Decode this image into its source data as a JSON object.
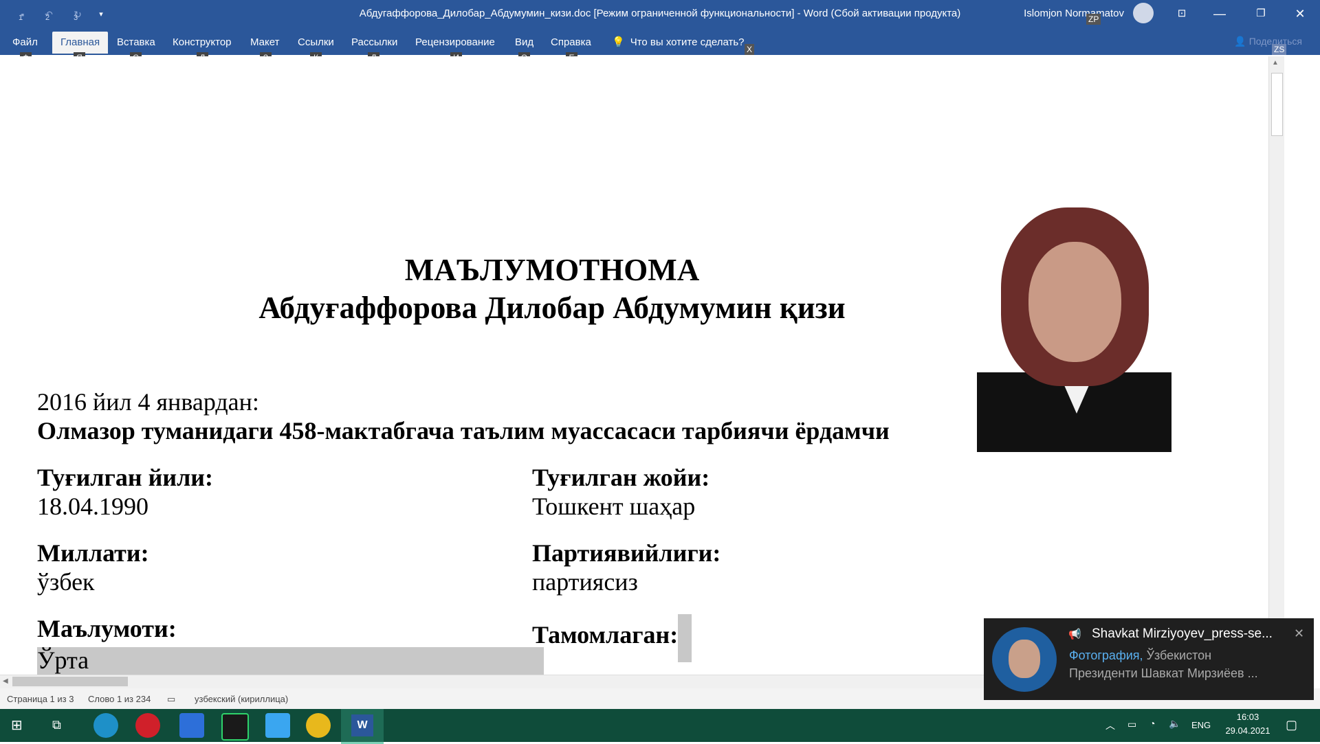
{
  "titlebar": {
    "title": "Абдугаффорова_Дилобар_Абдумумин_кизи.doc [Режим ограниченной функциональности]  -  Word (Сбой активации продукта)",
    "user": "Islomjon Normamatov",
    "user_keytip": "ZP",
    "qat_keytips": [
      "1",
      "2",
      "3"
    ]
  },
  "ribbon": {
    "tabs": [
      {
        "label": "Файл",
        "keytip": "Ф"
      },
      {
        "label": "Главная",
        "keytip": "Я"
      },
      {
        "label": "Вставка",
        "keytip": "С"
      },
      {
        "label": "Конструктор",
        "keytip": "Д"
      },
      {
        "label": "Макет",
        "keytip": "З"
      },
      {
        "label": "Ссылки",
        "keytip": "К"
      },
      {
        "label": "Рассылки",
        "keytip": "Л"
      },
      {
        "label": "Рецензирование",
        "keytip": "И"
      },
      {
        "label": "Вид",
        "keytip": "О"
      },
      {
        "label": "Справка",
        "keytip": "Е"
      }
    ],
    "tell_me": "Что вы хотите сделать?",
    "tell_me_keytip": "X",
    "share": "Поделиться",
    "share_keytip": "ZS"
  },
  "document": {
    "heading": "МАЪЛУМОТНОМА",
    "name": "Абдуғаффорова Дилобар Абдумумин қизи",
    "since": "2016 йил 4 январдан:",
    "position": "Олмазор туманидаги 458-мактабгача таълим муассасаси тарбиячи ёрдамчи",
    "fields": {
      "birth_year_label": "Туғилган йили:",
      "birth_year": "18.04.1990",
      "birth_place_label": "Туғилган жойи:",
      "birth_place": "Тошкент шаҳар",
      "nation_label": "Миллати:",
      "nation": "ўзбек",
      "party_label": "Партиявийлиги:",
      "party": "партиясиз",
      "education_label": "Маълумоти:",
      "education": "Ўрта",
      "graduated_label": "Тамомлаган:"
    }
  },
  "status": {
    "page": "Страница 1 из 3",
    "words": "Слово 1 из 234",
    "language": "узбекский (кириллица)"
  },
  "taskbar": {
    "time": "16:03",
    "date": "29.04.2021",
    "lang": "ENG"
  },
  "toast": {
    "title": "Shavkat Mirziyoyev_press-se...",
    "line1_link": "Фотография,",
    "line1_rest": " Ўзбекистон",
    "line2": "Президенти Шавкат Мирзиёев ..."
  }
}
